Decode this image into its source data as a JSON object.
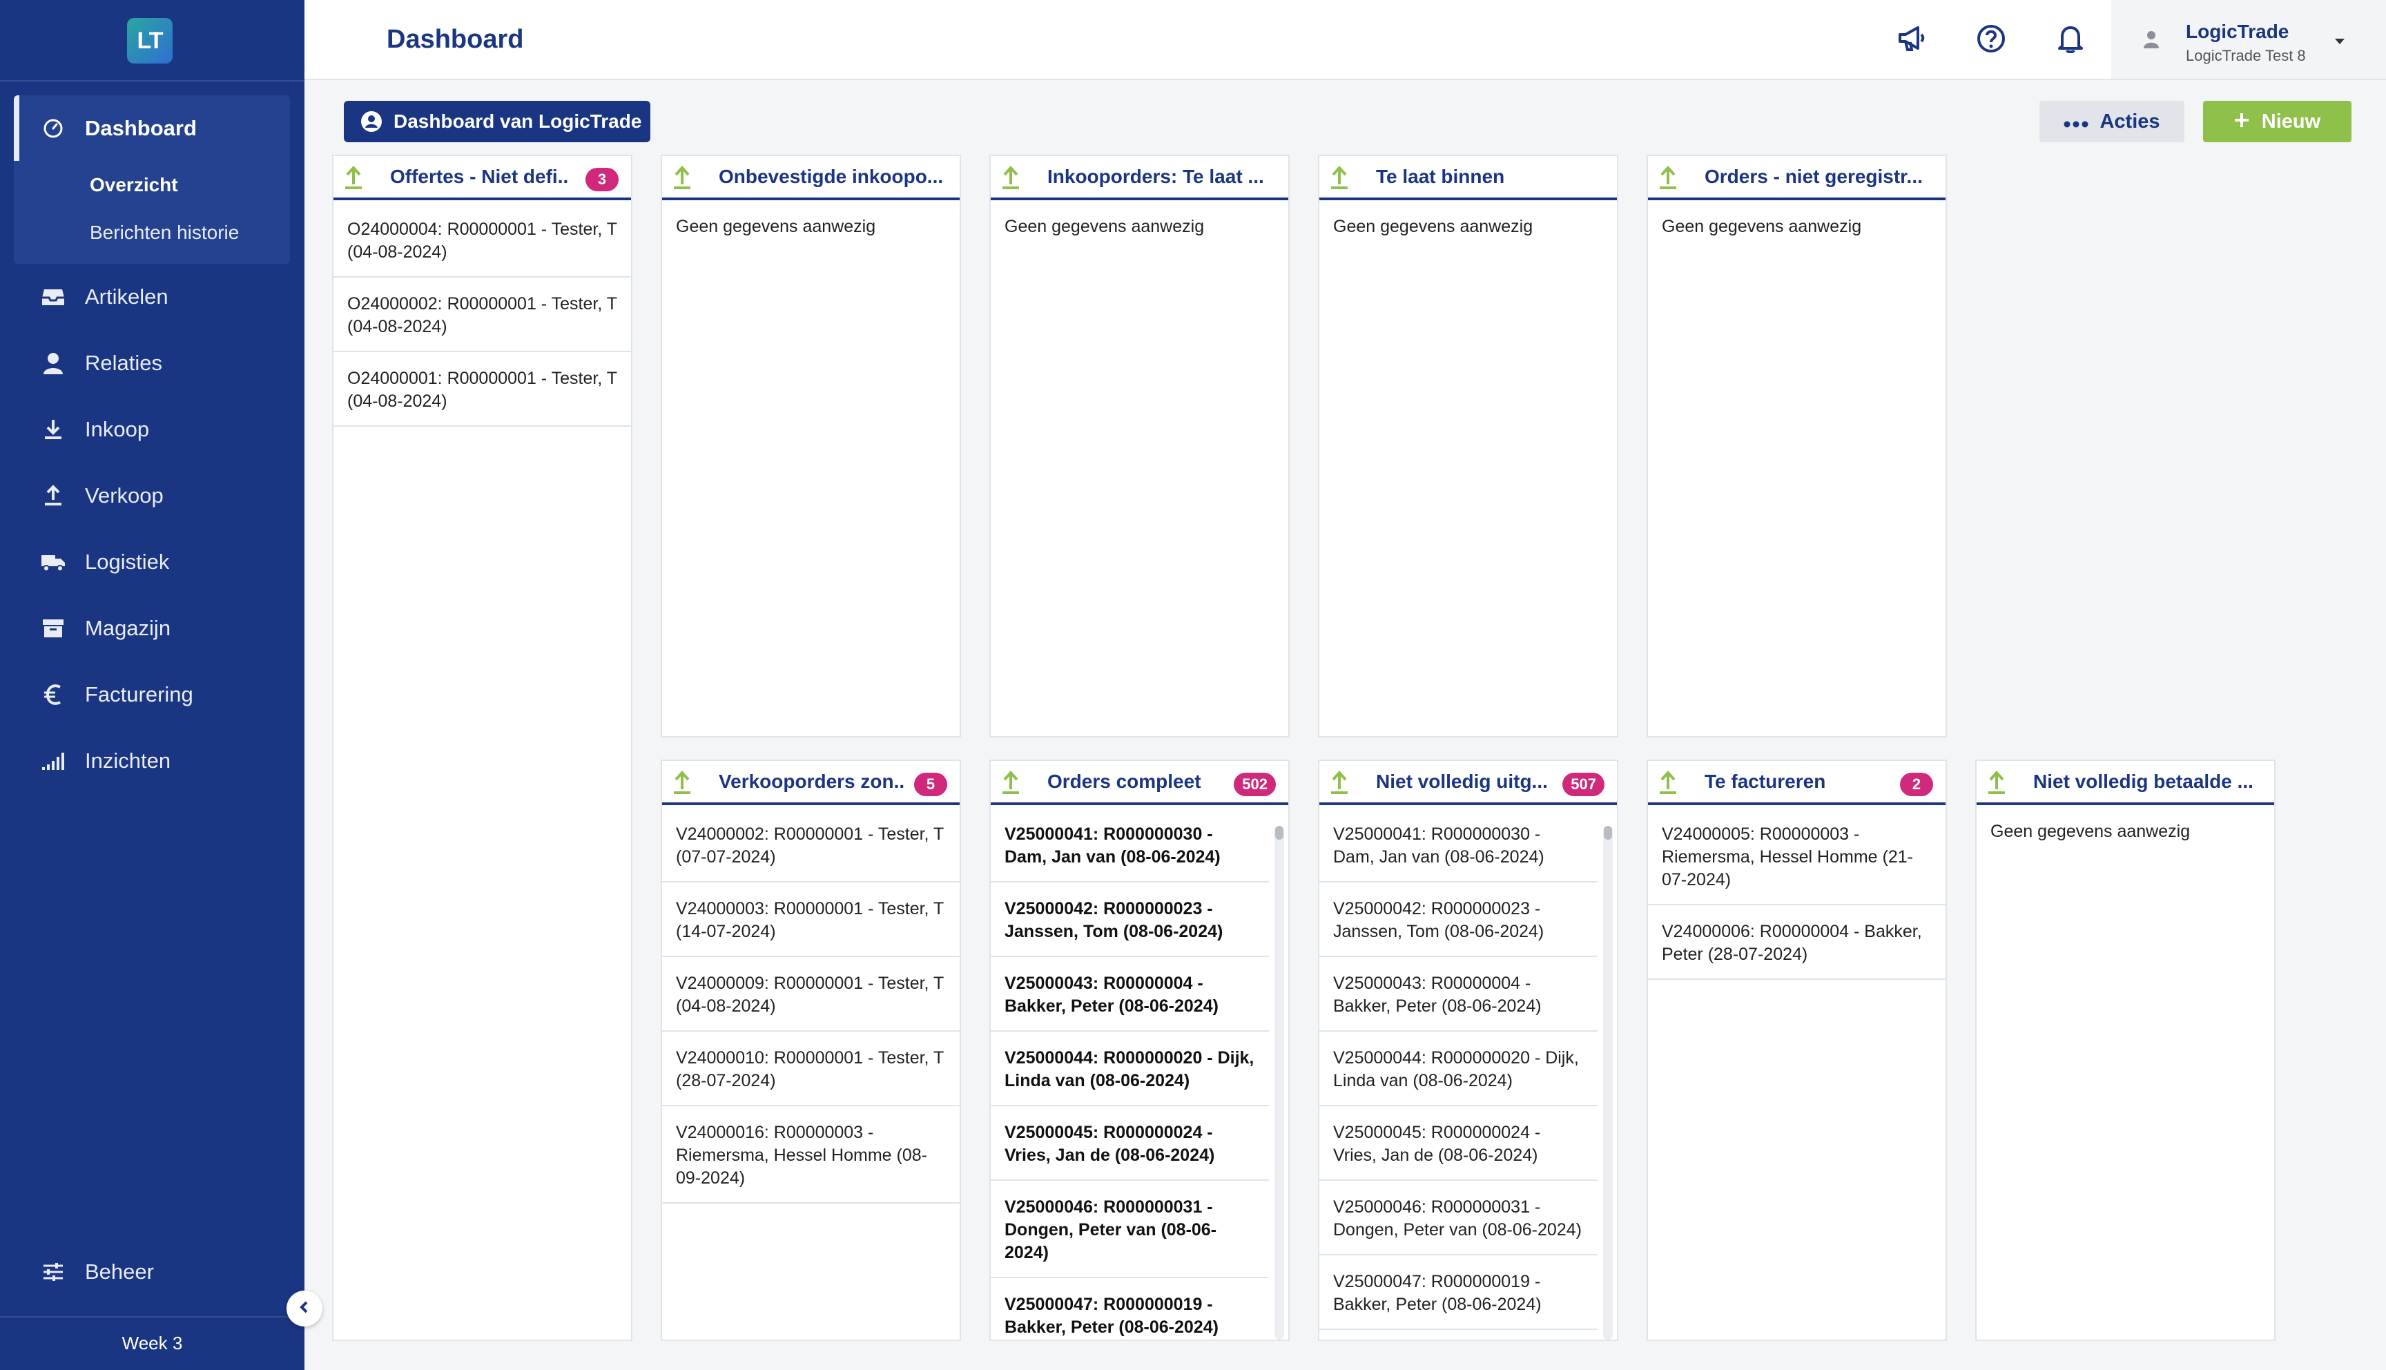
{
  "app": {
    "logo_text": "LT",
    "page_title": "Dashboard",
    "week_label": "Week 3",
    "colors": {
      "sidebar": "#1a3582",
      "accent_green": "#8ec04a",
      "badge": "#d0287a",
      "primary": "#1a3582"
    }
  },
  "sidebar": {
    "items": [
      {
        "label": "Dashboard",
        "icon": "speedometer-icon"
      },
      {
        "label": "Artikelen",
        "icon": "inbox-icon"
      },
      {
        "label": "Relaties",
        "icon": "person-icon"
      },
      {
        "label": "Inkoop",
        "icon": "download-icon"
      },
      {
        "label": "Verkoop",
        "icon": "upload-icon"
      },
      {
        "label": "Logistiek",
        "icon": "truck-icon"
      },
      {
        "label": "Magazijn",
        "icon": "archive-box-icon"
      },
      {
        "label": "Facturering",
        "icon": "euro-icon"
      },
      {
        "label": "Inzichten",
        "icon": "signal-bars-icon"
      }
    ],
    "sub_items": [
      {
        "label": "Overzicht"
      },
      {
        "label": "Berichten historie"
      }
    ],
    "footer_item": {
      "label": "Beheer",
      "icon": "sliders-icon"
    }
  },
  "topbar": {
    "user_name": "LogicTrade",
    "user_company": "LogicTrade Test 8"
  },
  "actions": {
    "dashboard_label": "Dashboard van LogicTrade",
    "acties_label": "Acties",
    "nieuw_label": "Nieuw"
  },
  "empty_text": "Geen gegevens aanwezig",
  "widgets": {
    "w1": {
      "title": "Offertes - Niet defi...",
      "badge": "3",
      "rows": [
        "O24000004: R00000001 - Tester, T (04-08-2024)",
        "O24000002: R00000001 - Tester, T (04-08-2024)",
        "O24000001: R00000001 - Tester, T (04-08-2024)"
      ]
    },
    "w2": {
      "title": "Onbevestigde inkoopo..."
    },
    "w3": {
      "title": "Inkooporders: Te laat ..."
    },
    "w4": {
      "title": "Te laat binnen"
    },
    "w5": {
      "title": "Orders - niet geregistr..."
    },
    "w6": {
      "title": "Verkooporders zon...",
      "badge": "5",
      "rows": [
        "V24000002: R00000001 - Tester, T (07-07-2024)",
        "V24000003: R00000001 - Tester, T (14-07-2024)",
        "V24000009: R00000001 - Tester, T (04-08-2024)",
        "V24000010: R00000001 - Tester, T (28-07-2024)",
        "V24000016: R00000003 - Riemersma, Hessel Homme (08-09-2024)"
      ]
    },
    "w7": {
      "title": "Orders compleet",
      "badge": "502",
      "rows": [
        "V25000041: R000000030 - Dam, Jan van (08-06-2024)",
        "V25000042: R000000023 - Janssen, Tom (08-06-2024)",
        "V25000043: R00000004 - Bakker, Peter (08-06-2024)",
        "V25000044: R000000020 - Dijk, Linda van (08-06-2024)",
        "V25000045: R000000024 - Vries, Jan de (08-06-2024)",
        "V25000046: R000000031 - Dongen, Peter van (08-06-2024)",
        "V25000047: R000000019 - Bakker, Peter (08-06-2024)"
      ]
    },
    "w8": {
      "title": "Niet volledig uitg...",
      "badge": "507",
      "rows": [
        "V25000041: R000000030 - Dam, Jan van (08-06-2024)",
        "V25000042: R000000023 - Janssen, Tom (08-06-2024)",
        "V25000043: R00000004 - Bakker, Peter (08-06-2024)",
        "V25000044: R000000020 - Dijk, Linda van (08-06-2024)",
        "V25000045: R000000024 - Vries, Jan de (08-06-2024)",
        "V25000046: R000000031 - Dongen, Peter van (08-06-2024)",
        "V25000047: R000000019 - Bakker, Peter (08-06-2024)"
      ]
    },
    "w9": {
      "title": "Te factureren",
      "badge": "2",
      "rows": [
        "V24000005: R00000003 - Riemersma, Hessel Homme (21-07-2024)",
        "V24000006: R00000004 - Bakker, Peter (28-07-2024)"
      ]
    },
    "w10": {
      "title": "Niet volledig betaalde ..."
    }
  }
}
